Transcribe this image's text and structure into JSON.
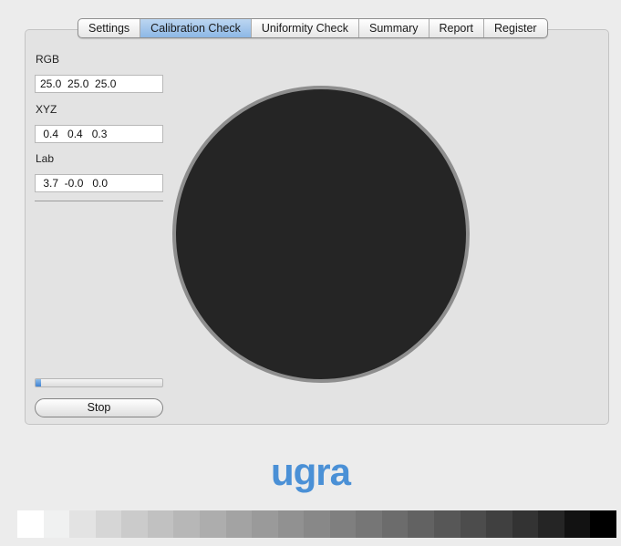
{
  "tabs": [
    {
      "label": "Settings",
      "active": false
    },
    {
      "label": "Calibration Check",
      "active": true
    },
    {
      "label": "Uniformity Check",
      "active": false
    },
    {
      "label": "Summary",
      "active": false
    },
    {
      "label": "Report",
      "active": false
    },
    {
      "label": "Register",
      "active": false
    }
  ],
  "readings": {
    "rgb_label": "RGB",
    "rgb_value": "25.0  25.0  25.0",
    "xyz_label": "XYZ",
    "xyz_value": " 0.4   0.4   0.3",
    "lab_label": "Lab",
    "lab_value": " 3.7  -0.0   0.0"
  },
  "progress": {
    "fraction": 0.04
  },
  "controls": {
    "stop_label": "Stop"
  },
  "patch": {
    "color": "#252525"
  },
  "logo": {
    "text": "ugra",
    "color": "#4a90d6"
  },
  "gray_wedge": [
    "#ffffff",
    "#f0f1f1",
    "#e3e3e3",
    "#d6d6d6",
    "#cbcbcb",
    "#c1c1c1",
    "#b7b7b7",
    "#adadad",
    "#a3a3a3",
    "#9a9a9a",
    "#919191",
    "#888888",
    "#7f7f7f",
    "#767676",
    "#6c6c6c",
    "#626262",
    "#575757",
    "#4c4c4c",
    "#404040",
    "#333333",
    "#252525",
    "#121212",
    "#000000"
  ]
}
